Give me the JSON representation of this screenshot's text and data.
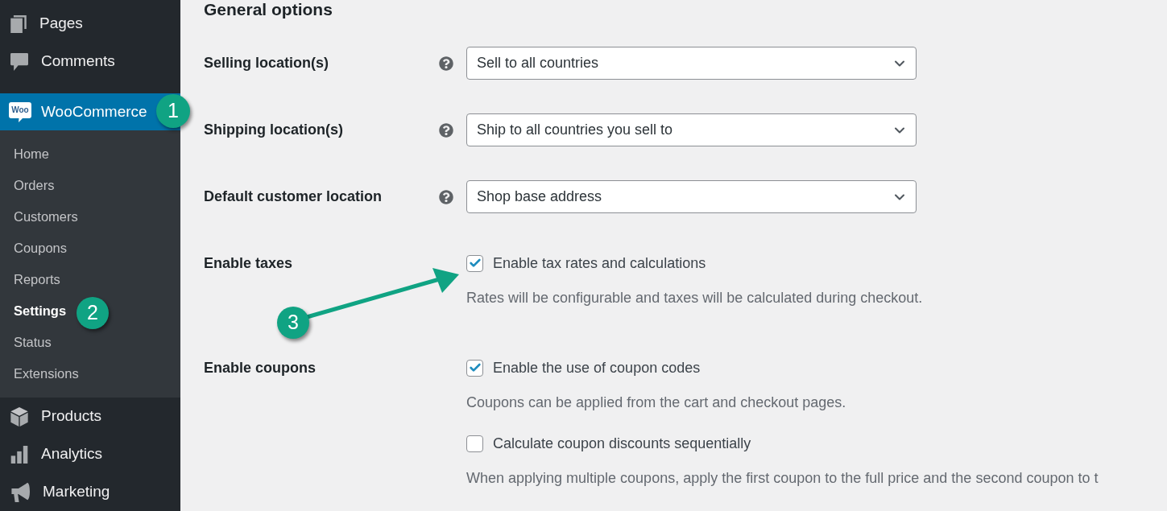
{
  "sidebar": {
    "items": [
      {
        "label": "Pages",
        "selected": false
      },
      {
        "label": "Comments",
        "selected": false
      },
      {
        "label": "WooCommerce",
        "logo_text": "Woo",
        "selected": true,
        "children": [
          {
            "label": "Home",
            "selected": false
          },
          {
            "label": "Orders",
            "selected": false
          },
          {
            "label": "Customers",
            "selected": false
          },
          {
            "label": "Coupons",
            "selected": false
          },
          {
            "label": "Reports",
            "selected": false
          },
          {
            "label": "Settings",
            "selected": true
          },
          {
            "label": "Status",
            "selected": false
          },
          {
            "label": "Extensions",
            "selected": false
          }
        ]
      },
      {
        "label": "Products",
        "selected": false
      },
      {
        "label": "Analytics",
        "selected": false
      },
      {
        "label": "Marketing",
        "selected": false
      }
    ]
  },
  "main": {
    "section_title": "General options",
    "settings": [
      {
        "kind": "select",
        "label": "Selling location(s)",
        "value": "Sell to all countries"
      },
      {
        "kind": "select",
        "label": "Shipping location(s)",
        "value": "Ship to all countries you sell to"
      },
      {
        "kind": "select",
        "label": "Default customer location",
        "value": "Shop base address"
      },
      {
        "kind": "checkboxes",
        "label": "Enable taxes",
        "options": [
          {
            "label": "Enable tax rates and calculations",
            "checked": true,
            "description": "Rates will be configurable and taxes will be calculated during checkout."
          }
        ]
      },
      {
        "kind": "checkboxes",
        "label": "Enable coupons",
        "options": [
          {
            "label": "Enable the use of coupon codes",
            "checked": true,
            "description": "Coupons can be applied from the cart and checkout pages."
          },
          {
            "label": "Calculate coupon discounts sequentially",
            "checked": false,
            "description": "When applying multiple coupons, apply the first coupon to the full price and the second coupon to t"
          }
        ]
      }
    ]
  },
  "annotations": [
    {
      "label": "1"
    },
    {
      "label": "2"
    },
    {
      "label": "3"
    }
  ]
}
